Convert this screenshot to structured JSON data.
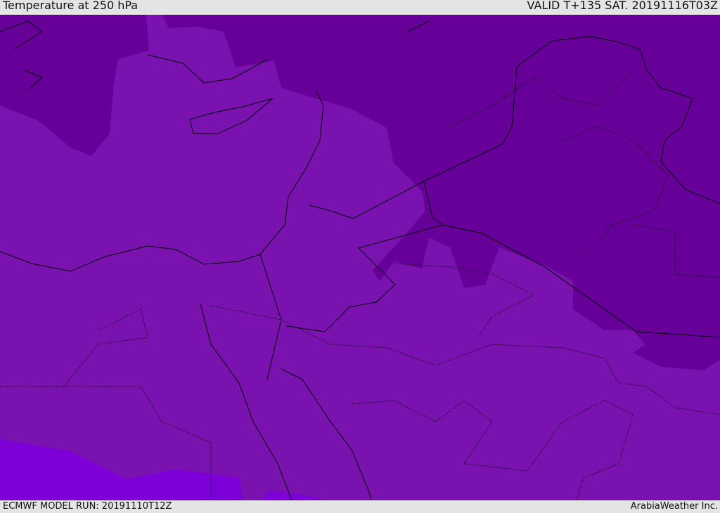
{
  "header": {
    "title": "Temperature at 250 hPa",
    "valid": "VALID T+135 SAT. 20191116T03Z"
  },
  "footer": {
    "model_run": "ECMWF MODEL RUN: 20191110T12Z",
    "credit": "ArabiaWeather Inc."
  },
  "colors": {
    "cold": "#660099",
    "mid": "#7a12b0",
    "warm": "#7d00d8"
  }
}
